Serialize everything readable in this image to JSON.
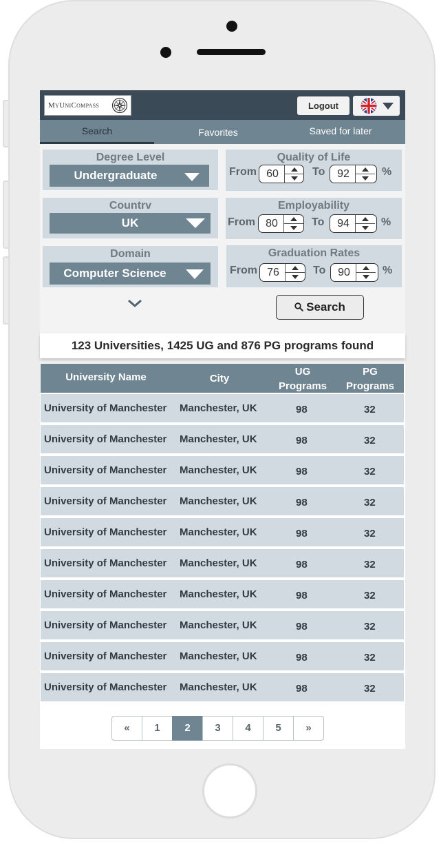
{
  "header": {
    "logo_text": "MyUniCompass",
    "logout_label": "Logout",
    "language": "English (UK)"
  },
  "tabs": [
    {
      "label": "Search",
      "active": true
    },
    {
      "label": "Favorites",
      "active": false
    },
    {
      "label": "Saved for later",
      "active": false
    }
  ],
  "filters": {
    "degree_level": {
      "label": "Degree Level",
      "value": "Undergraduate"
    },
    "country": {
      "label": "Countrv",
      "value": "UK"
    },
    "domain": {
      "label": "Domain",
      "value": "Computer Science"
    },
    "quality_of_life": {
      "label": "Quality of Life",
      "from_label": "From",
      "from": "60",
      "to_label": "To",
      "to": "92",
      "unit": "%"
    },
    "employability": {
      "label": "Employability",
      "from_label": "From",
      "from": "80",
      "to_label": "To",
      "to": "94",
      "unit": "%"
    },
    "graduation_rates": {
      "label": "Graduation Rates",
      "from_label": "From",
      "from": "76",
      "to_label": "To",
      "to": "90",
      "unit": "%"
    },
    "search_label": "Search"
  },
  "results_summary": "123 Universities, 1425 UG and 876 PG programs found",
  "table": {
    "headers": {
      "name": "University Name",
      "city": "City",
      "ug_line1": "UG",
      "ug_line2": "Programs",
      "pg_line1": "PG",
      "pg_line2": "Programs"
    },
    "rows": [
      {
        "name": "University of Manchester",
        "city": "Manchester, UK",
        "ug": "98",
        "pg": "32"
      },
      {
        "name": "University of Manchester",
        "city": "Manchester, UK",
        "ug": "98",
        "pg": "32"
      },
      {
        "name": "University of Manchester",
        "city": "Manchester, UK",
        "ug": "98",
        "pg": "32"
      },
      {
        "name": "University of Manchester",
        "city": "Manchester, UK",
        "ug": "98",
        "pg": "32"
      },
      {
        "name": "University of Manchester",
        "city": "Manchester, UK",
        "ug": "98",
        "pg": "32"
      },
      {
        "name": "University of Manchester",
        "city": "Manchester, UK",
        "ug": "98",
        "pg": "32"
      },
      {
        "name": "University of Manchester",
        "city": "Manchester, UK",
        "ug": "98",
        "pg": "32"
      },
      {
        "name": "University of Manchester",
        "city": "Manchester, UK",
        "ug": "98",
        "pg": "32"
      },
      {
        "name": "University of Manchester",
        "city": "Manchester, UK",
        "ug": "98",
        "pg": "32"
      },
      {
        "name": "University of Manchester",
        "city": "Manchester, UK",
        "ug": "98",
        "pg": "32"
      }
    ]
  },
  "pagination": {
    "prev": "«",
    "pages": [
      "1",
      "2",
      "3",
      "4",
      "5"
    ],
    "current": "2",
    "next": "»"
  }
}
